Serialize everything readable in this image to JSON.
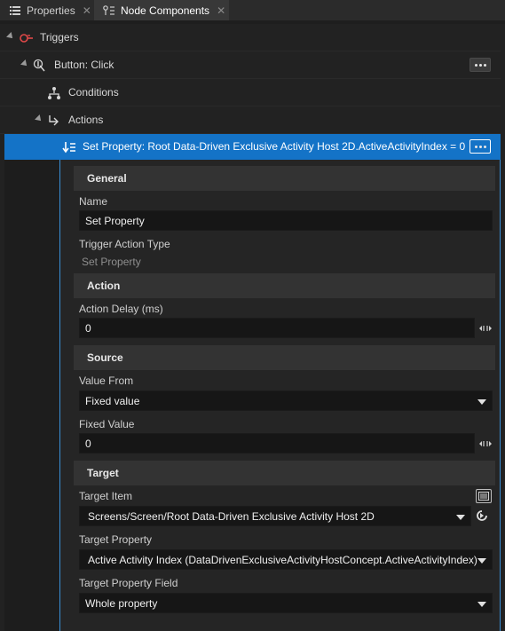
{
  "tabs": [
    {
      "label": "Properties",
      "close": "✕"
    },
    {
      "label": "Node Components",
      "close": "✕"
    }
  ],
  "tree": {
    "triggers": "Triggers",
    "button_click": "Button: Click",
    "conditions": "Conditions",
    "actions": "Actions",
    "set_property": "Set Property: Root Data-Driven Exclusive Activity Host 2D.ActiveActivityIndex = 0"
  },
  "panel": {
    "general": {
      "header": "General",
      "name_label": "Name",
      "name_value": "Set Property",
      "type_label": "Trigger Action Type",
      "type_value": "Set Property"
    },
    "action": {
      "header": "Action",
      "delay_label": "Action Delay (ms)",
      "delay_value": "0"
    },
    "source": {
      "header": "Source",
      "value_from_label": "Value From",
      "value_from_selected": "Fixed value",
      "fixed_value_label": "Fixed Value",
      "fixed_value": "0"
    },
    "target": {
      "header": "Target",
      "item_label": "Target Item",
      "item_value": "Screens/Screen/Root Data-Driven Exclusive Activity Host 2D",
      "property_label": "Target Property",
      "property_value": "Active Activity Index (DataDrivenExclusiveActivityHostConcept.ActiveActivityIndex)",
      "field_label": "Target Property Field",
      "field_value": "Whole property"
    }
  },
  "colors": {
    "selection": "#1473c7",
    "panel_border": "#3a8fd6",
    "trigger_icon": "#e04848"
  }
}
